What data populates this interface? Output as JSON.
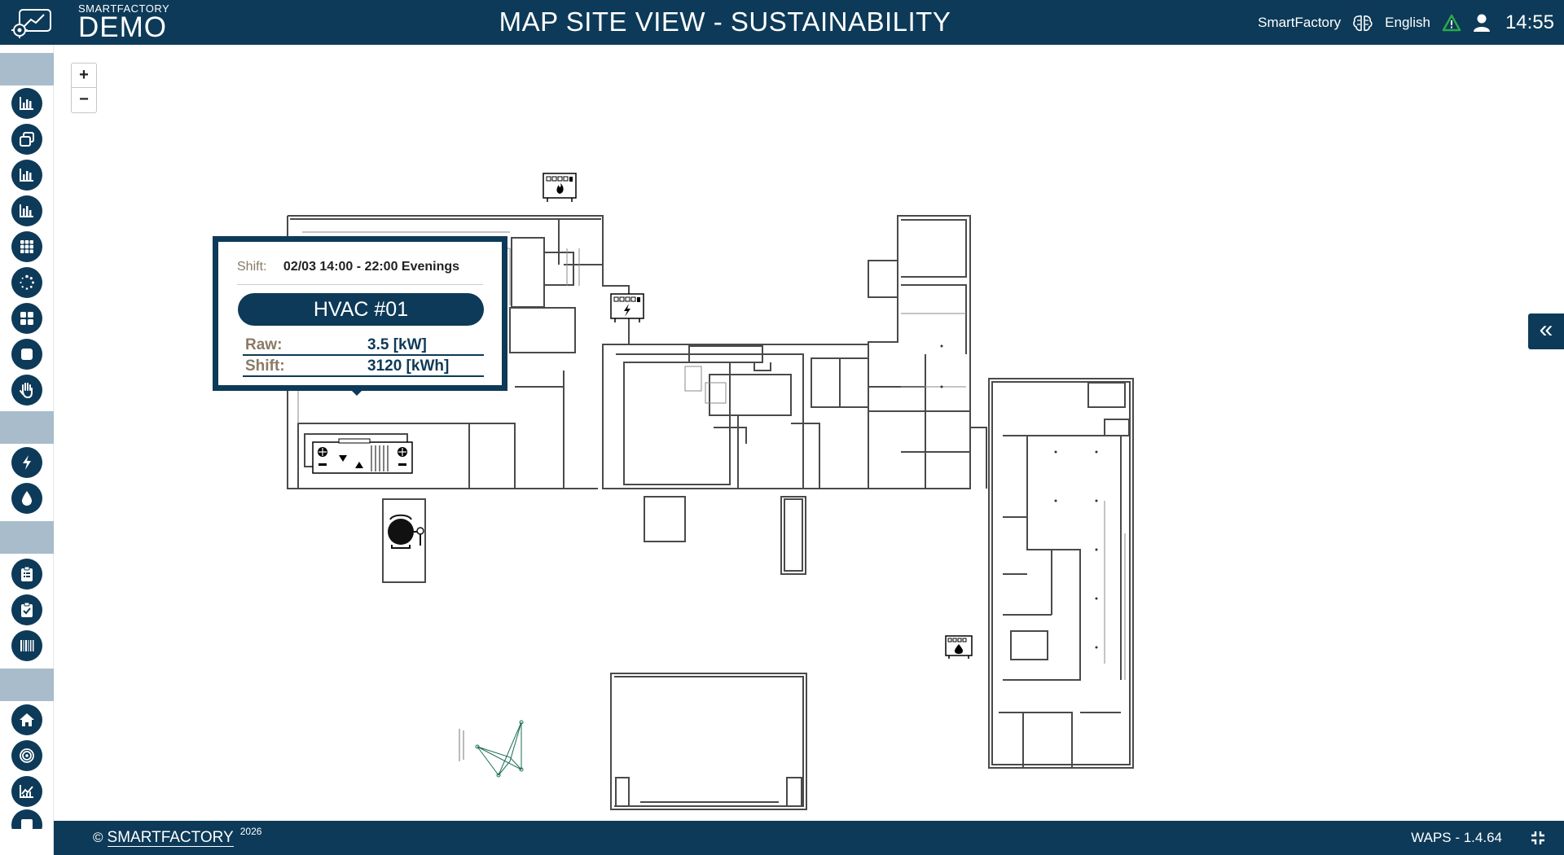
{
  "header": {
    "brand_small": "SMARTFACTORY",
    "brand_big": "DEMO",
    "title": "MAP SITE VIEW - SUSTAINABILITY",
    "tenant": "SmartFactory",
    "language": "English",
    "time": "14:55"
  },
  "sidebar": {
    "group1": [
      "bar-chart-icon",
      "copy-windows-icon",
      "bar-chart-icon",
      "bar-chart-icon",
      "grid-icon",
      "dots-circle-icon",
      "tiles-icon",
      "square-icon",
      "hand-icon"
    ],
    "group2": [
      "lightning-icon",
      "water-drop-icon"
    ],
    "group3": [
      "clipboard-list-icon",
      "clipboard-check-icon",
      "barcode-icon"
    ],
    "group4": [
      "home-icon",
      "target-icon",
      "line-chart-icon",
      "clipboard-icon"
    ]
  },
  "map": {
    "zoom_in": "+",
    "zoom_out": "−",
    "markers": [
      "gas-meter-icon",
      "electric-meter-icon",
      "water-meter-icon",
      "hvac-unit-icon",
      "boiler-tank-icon",
      "compass-rose-icon"
    ]
  },
  "popup": {
    "shift_label": "Shift:",
    "shift_value": "02/03 14:00 - 22:00 Evenings",
    "asset_name": "HVAC #01",
    "rows": [
      {
        "label": "Raw:",
        "value": "3.5 [kW]"
      },
      {
        "label": "Shift:",
        "value": "3120 [kWh]"
      }
    ]
  },
  "collapse_label": "«",
  "footer": {
    "copyright_symbol": "©",
    "brand": "SMARTFACTORY",
    "year": "2026",
    "version": "WAPS - 1.4.64"
  },
  "colors": {
    "primary": "#0d3a58",
    "separator": "#a8bccb",
    "label_brown": "#8a7a66",
    "alert_green": "#2ea84a"
  }
}
